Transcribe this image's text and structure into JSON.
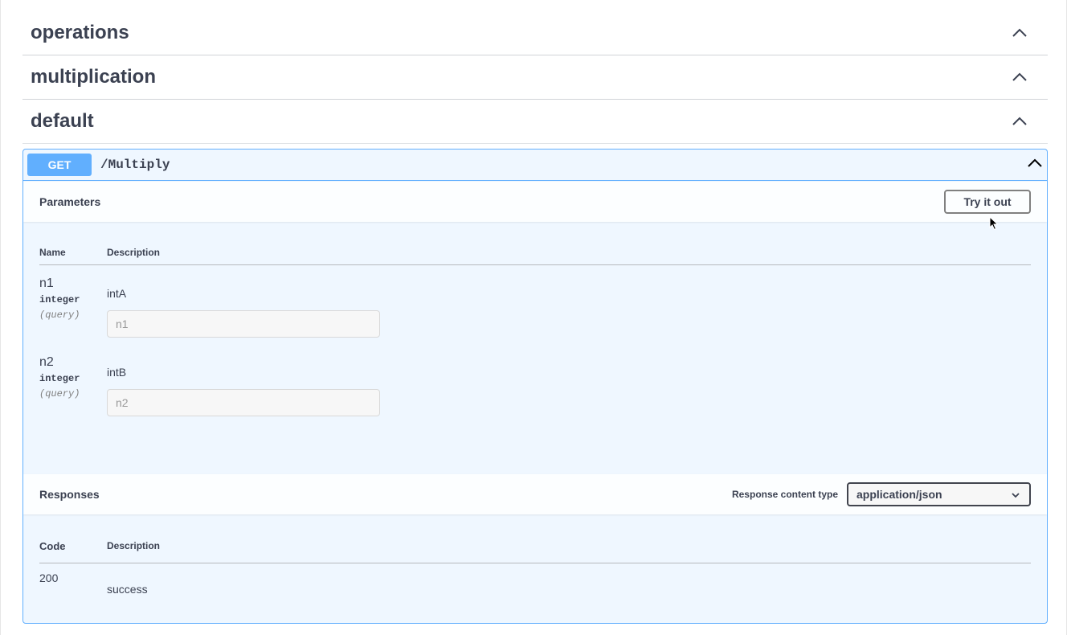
{
  "tags": [
    {
      "title": "operations"
    },
    {
      "title": "multiplication"
    },
    {
      "title": "default"
    }
  ],
  "operation": {
    "method": "GET",
    "path": "/Multiply"
  },
  "parameters": {
    "title": "Parameters",
    "try_button": "Try it out",
    "headers": {
      "name": "Name",
      "description": "Description"
    },
    "items": [
      {
        "name": "n1",
        "type": "integer",
        "in": "(query)",
        "description": "intA",
        "placeholder": "n1"
      },
      {
        "name": "n2",
        "type": "integer",
        "in": "(query)",
        "description": "intB",
        "placeholder": "n2"
      }
    ]
  },
  "responses": {
    "title": "Responses",
    "content_type_label": "Response content type",
    "content_type_value": "application/json",
    "headers": {
      "code": "Code",
      "description": "Description"
    },
    "items": [
      {
        "code": "200",
        "description": "success"
      }
    ]
  },
  "colors": {
    "get_accent": "#61affe",
    "text": "#3b4151"
  },
  "icons": {
    "collapse": "chevron-up-icon",
    "dropdown": "chevron-down-icon",
    "cursor": "mouse-pointer-icon"
  }
}
